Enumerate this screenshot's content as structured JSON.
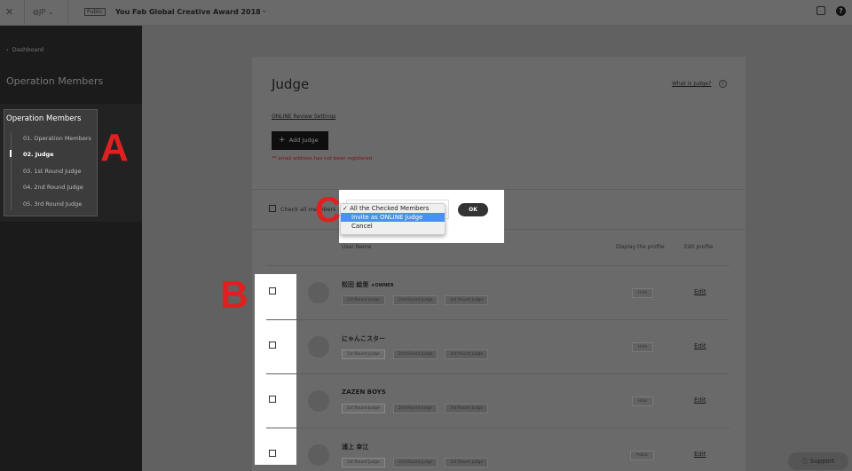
{
  "topbar": {
    "lang": "JP",
    "status_badge": "Public",
    "project_title": "You Fab Global Creative Award 2018"
  },
  "sidebar": {
    "back_label": "Dashboard",
    "section_title": "Operation Members",
    "group_title": "Operation Members",
    "items": [
      {
        "label": "01. Operation Members"
      },
      {
        "label": "02. Judge",
        "active": true
      },
      {
        "label": "03. 1st Round Judge"
      },
      {
        "label": "04. 2nd Round Judge"
      },
      {
        "label": "05. 3rd Round Judge"
      }
    ]
  },
  "main": {
    "title": "Judge",
    "what_is_link": "What is Judge?",
    "online_settings_link": "ONLINE Review Settings",
    "add_button": "Add Judge",
    "warning": "** email address has not been registered",
    "check_all_label": "Check all members",
    "ok_button": "OK",
    "action_menu": {
      "options": [
        "All the Checked Members",
        "Invite as ONLINE Judge",
        "Cancel"
      ],
      "selected": "All the Checked Members",
      "highlighted": "Invite as ONLINE Judge"
    },
    "columns": {
      "user_name": "User Name",
      "display_profile": "Display the profile",
      "edit_profile": "Edit profile"
    },
    "rows": [
      {
        "name": "松田 絵里",
        "owner": "★OWNER",
        "tags": [
          "1st Round Judge",
          "2nd Round Judge",
          "3rd Round Judge"
        ],
        "first_tag_active": false,
        "visibility": "Hide",
        "edit": "Edit"
      },
      {
        "name": "にゃんこスター",
        "owner": "",
        "tags": [
          "1st Round Judge",
          "2nd Round Judge",
          "3rd Round Judge"
        ],
        "first_tag_active": true,
        "visibility": "Hide",
        "edit": "Edit"
      },
      {
        "name": "ZAZEN BOYS",
        "owner": "",
        "tags": [
          "1st Round Judge",
          "2nd Round Judge",
          "3rd Round Judge"
        ],
        "first_tag_active": true,
        "visibility": "Hide",
        "edit": "Edit"
      },
      {
        "name": "浦上 幸江",
        "owner": "",
        "tags": [
          "1st Round Judge",
          "2nd Round Judge",
          "3rd Round Judge"
        ],
        "first_tag_active": true,
        "visibility": "Public",
        "edit": "Edit"
      }
    ]
  },
  "annotations": {
    "a": "A",
    "b": "B",
    "c": "C"
  },
  "support_button": "Support",
  "colors": {
    "annotation": "#e02020",
    "menu_highlight": "#4a90f0",
    "sidebar": "#1b1b1b"
  }
}
